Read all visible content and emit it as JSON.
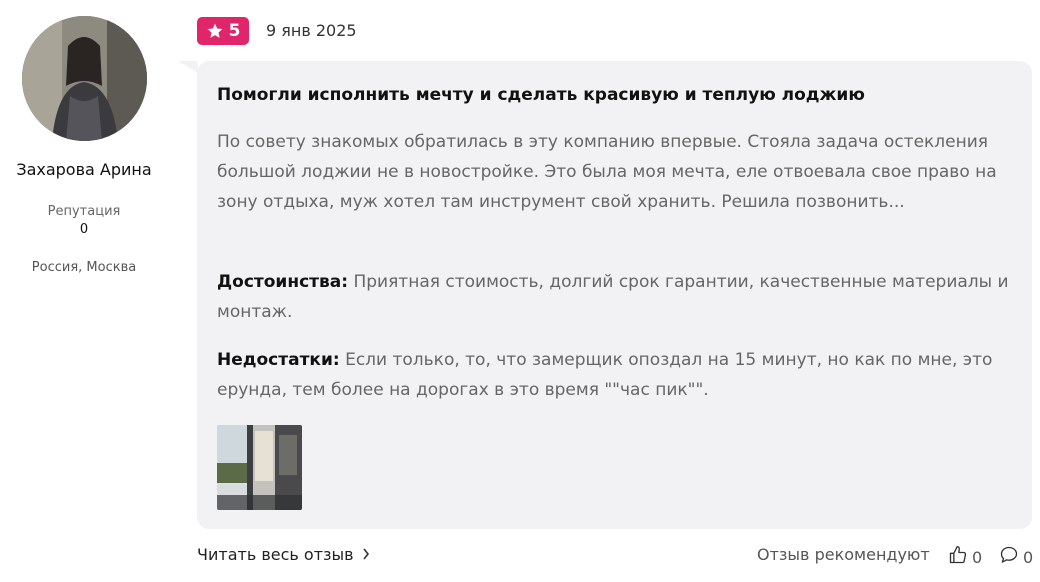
{
  "author": {
    "name": "Захарова Арина",
    "reputation_label": "Репутация",
    "reputation_value": "0",
    "location": "Россия, Москва",
    "avatar": "avatar-photo"
  },
  "review": {
    "rating": "5",
    "rating_icon": "star-icon",
    "date": "9 янв 2025",
    "title": "Помогли исполнить мечту и сделать красивую и теплую лоджию",
    "text": "По совету знакомых обратилась в эту компанию впервые. Стояла задача остекления большой лоджии не в новостройке. Это была моя мечта, еле отвоевала свое право на зону отдыха, муж хотел там инструмент свой хранить. Решила позвонить...",
    "pros_label": "Достоинства:",
    "pros_text": "Приятная стоимость, долгий срок гарантии, качественные материалы и монтаж.",
    "cons_label": "Недостатки:",
    "cons_text": "Если только, то, что замерщик опоздал на 15 минут, но как по мне, это ерунда, тем более на дорогах в это время \"\"час пик\"\".",
    "photo": "loggia-photo-thumbnail"
  },
  "footer": {
    "read_more": "Читать весь отзыв",
    "read_more_icon": "chevron-right-icon",
    "recommend_text": "Отзыв рекомендуют",
    "likes_count": "0",
    "likes_icon": "thumbs-up-icon",
    "comments_count": "0",
    "comments_icon": "comment-icon"
  },
  "colors": {
    "rating_badge": "#e0256a",
    "card_bg": "#f2f2f4"
  }
}
